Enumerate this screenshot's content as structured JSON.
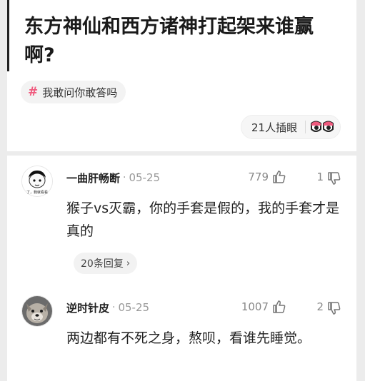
{
  "post": {
    "title": "东方神仙和西方诸神打起架来谁赢啊?",
    "topic_tag": "我敢问你敢答吗",
    "cheer_label": "21人插眼"
  },
  "comments": [
    {
      "username": "一曲肝畅断",
      "date": "05-25",
      "likes": "779",
      "dislikes": "1",
      "text": "猴子vs灭霸，你的手套是假的，我的手套才是真的",
      "replies_label": "20条回复",
      "avatar_caption": "了，我就看看"
    },
    {
      "username": "逆时针皮",
      "date": "05-25",
      "likes": "1007",
      "dislikes": "2",
      "text": "两边都有不死之身，熬呗，看谁先睡觉。"
    }
  ],
  "colors": {
    "accent": "#f05a7e",
    "muted": "#999999",
    "background": "#ececec"
  },
  "icons": [
    "hash-icon",
    "eyes-icon",
    "thumbs-up-icon",
    "thumbs-down-icon",
    "chevron-right-icon"
  ]
}
